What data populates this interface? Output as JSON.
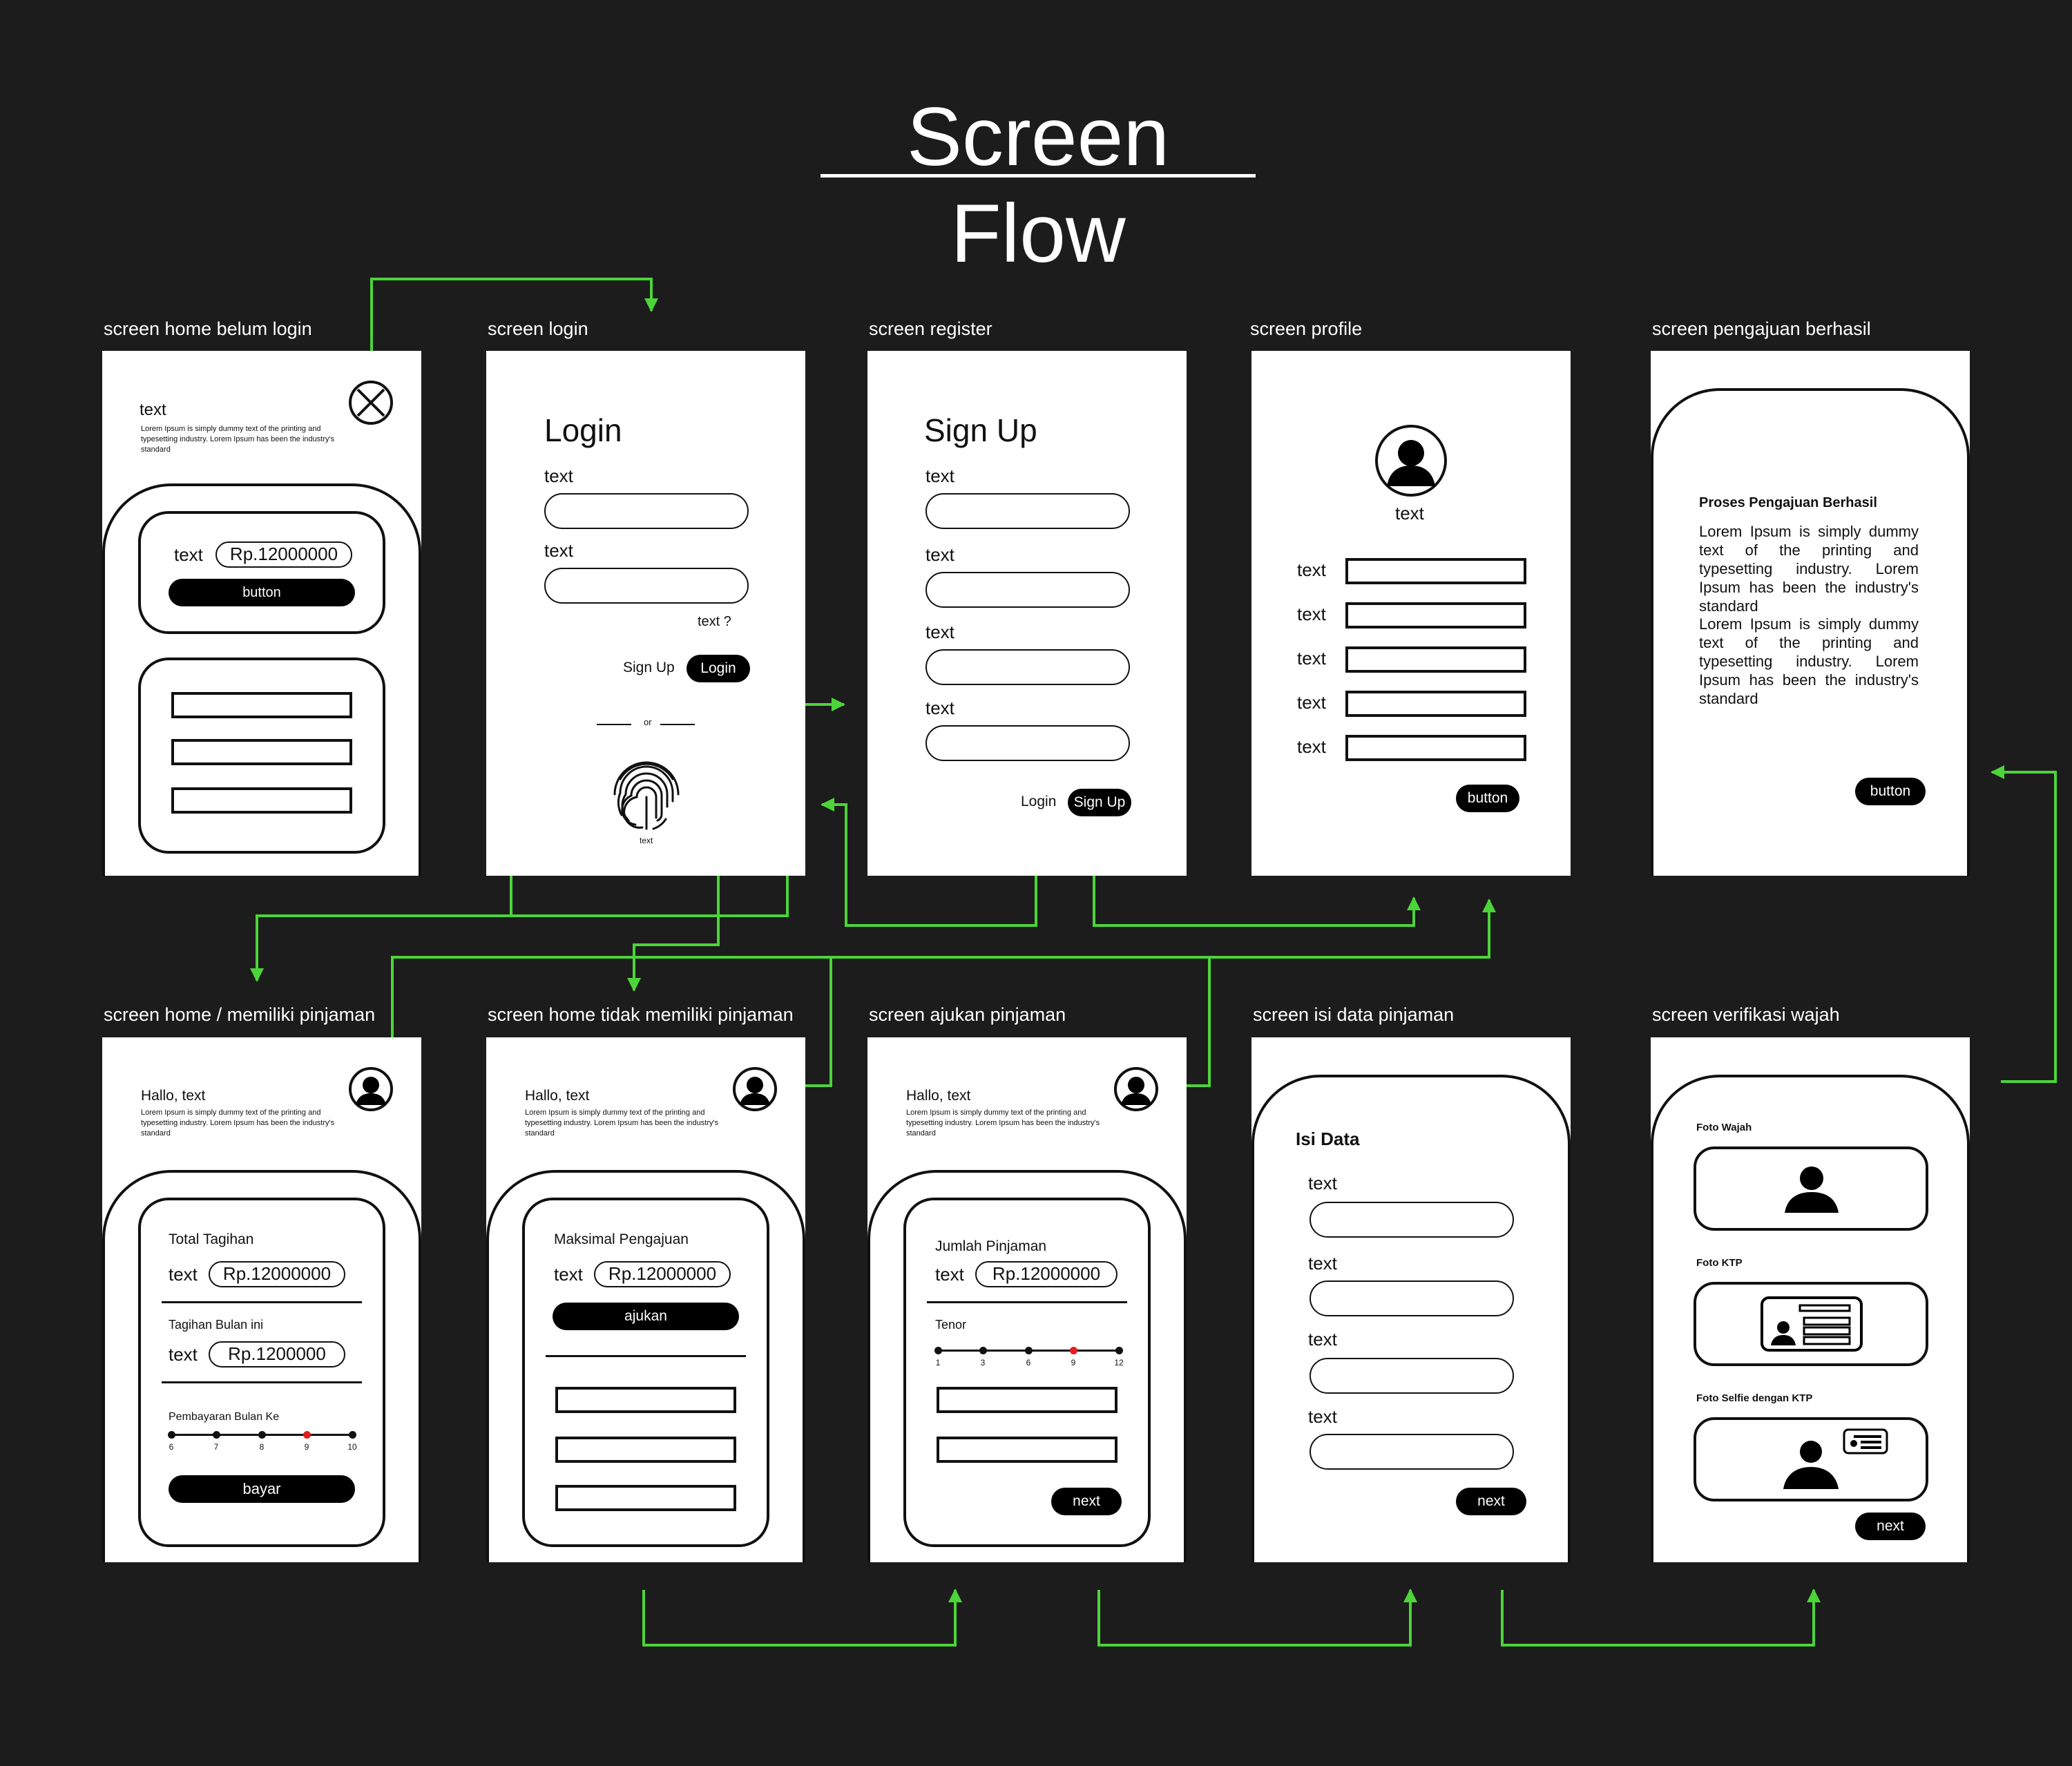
{
  "title": "Screen Flow",
  "colors": {
    "background": "#1c1c1c",
    "connector": "#4cd43a",
    "screen": "#ffffff",
    "accent_red": "#e02020"
  },
  "lorem_short": "Lorem Ipsum is simply dummy text of the printing and typesetting industry. Lorem Ipsum has been the industry's standard",
  "screens": {
    "home_guest": {
      "label": "screen home belum login",
      "heading": "text",
      "card_text": "text",
      "amount": "Rp.12000000",
      "button": "button",
      "close_icon": "close-circle-icon"
    },
    "login": {
      "label": "screen login",
      "heading": "Login",
      "field1": "text",
      "field2": "text",
      "forgot": "text ?",
      "signup": "Sign Up",
      "login_btn": "Login",
      "or": "or",
      "fingerprint_caption": "text",
      "fingerprint_icon": "fingerprint-icon"
    },
    "register": {
      "label": "screen register",
      "heading": "Sign Up",
      "fields": [
        "text",
        "text",
        "text",
        "text"
      ],
      "login": "Login",
      "signup_btn": "Sign Up"
    },
    "profile": {
      "label": "screen profile",
      "name": "text",
      "fields": [
        "text",
        "text",
        "text",
        "text",
        "text"
      ],
      "button": "button"
    },
    "success": {
      "label": "screen pengajuan berhasil",
      "heading": "Proses Pengajuan Berhasil",
      "body1": "Lorem Ipsum is simply dummy text of the printing and typesetting industry. Lorem Ipsum has been the industry's standard",
      "body2": "Lorem Ipsum is simply dummy text of the printing and typesetting industry. Lorem Ipsum has been the industry's standard",
      "button": "button"
    },
    "home_loan": {
      "label": "screen home / memiliki pinjaman",
      "greeting": "Hallo, text",
      "total_label": "Total Tagihan",
      "total_text": "text",
      "total_amount": "Rp.12000000",
      "month_label": "Tagihan Bulan ini",
      "month_text": "text",
      "month_amount": "Rp.1200000",
      "payment_label": "Pembayaran Bulan Ke",
      "ticks": [
        "6",
        "7",
        "8",
        "9",
        "10"
      ],
      "selected_tick": "9",
      "button": "bayar"
    },
    "home_noloan": {
      "label": "screen home tidak memiliki pinjaman",
      "greeting": "Hallo, text",
      "max_label": "Maksimal Pengajuan",
      "max_text": "text",
      "max_amount": "Rp.12000000",
      "button": "ajukan"
    },
    "apply": {
      "label": "screen ajukan pinjaman",
      "greeting": "Hallo, text",
      "amount_label": "Jumlah Pinjaman",
      "amount_text": "text",
      "amount": "Rp.12000000",
      "tenor_label": "Tenor",
      "ticks": [
        "1",
        "3",
        "6",
        "9",
        "12"
      ],
      "selected_tick": "9",
      "button": "next"
    },
    "fill_data": {
      "label": "screen isi data pinjaman",
      "heading": "Isi Data",
      "fields": [
        "text",
        "text",
        "text",
        "text"
      ],
      "button": "next"
    },
    "verify": {
      "label": "screen verifikasi wajah",
      "photo_face": "Foto Wajah",
      "photo_id": "Foto KTP",
      "photo_selfie": "Foto Selfie dengan KTP",
      "button": "next"
    }
  }
}
